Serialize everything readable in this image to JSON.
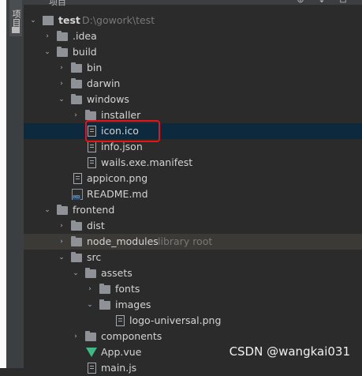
{
  "panel": {
    "tab_label": "项目",
    "header_title": "项目"
  },
  "header_buttons": [
    {
      "name": "crosshair-button",
      "glyph": "⊕"
    },
    {
      "name": "collapse-all-button",
      "glyph": "⇟"
    },
    {
      "name": "collapse-button",
      "glyph": "⊟"
    }
  ],
  "tree": {
    "root_name": "test",
    "root_path": "D:\\gowork\\test",
    "items": [
      {
        "label": ".idea",
        "type": "folder",
        "arrow": "›"
      },
      {
        "label": "build",
        "type": "folder",
        "arrow": "⌄"
      },
      {
        "label": "bin",
        "type": "folder",
        "arrow": "›"
      },
      {
        "label": "darwin",
        "type": "folder",
        "arrow": "›"
      },
      {
        "label": "windows",
        "type": "folder",
        "arrow": "⌄"
      },
      {
        "label": "installer",
        "type": "folder",
        "arrow": "›"
      },
      {
        "label": "icon.ico",
        "type": "file",
        "selected": true
      },
      {
        "label": "info.json",
        "type": "file"
      },
      {
        "label": "wails.exe.manifest",
        "type": "file"
      },
      {
        "label": "appicon.png",
        "type": "file"
      },
      {
        "label": "README.md",
        "type": "markdown"
      },
      {
        "label": "frontend",
        "type": "folder",
        "arrow": "⌄"
      },
      {
        "label": "dist",
        "type": "folder",
        "arrow": "›"
      },
      {
        "label": "node_modules",
        "type": "folder",
        "arrow": "›",
        "hint": "library root"
      },
      {
        "label": "src",
        "type": "folder",
        "arrow": "⌄"
      },
      {
        "label": "assets",
        "type": "folder",
        "arrow": "⌄"
      },
      {
        "label": "fonts",
        "type": "folder",
        "arrow": "›"
      },
      {
        "label": "images",
        "type": "folder",
        "arrow": "⌄"
      },
      {
        "label": "logo-universal.png",
        "type": "file"
      },
      {
        "label": "components",
        "type": "folder",
        "arrow": "›"
      },
      {
        "label": "App.vue",
        "type": "vue"
      },
      {
        "label": "main.js",
        "type": "file"
      }
    ]
  },
  "watermark": "CSDN @wangkai031",
  "colors": {
    "selected_row": "#0d293e",
    "highlight_border": "#e4151a",
    "vue_green": "#41b883"
  }
}
